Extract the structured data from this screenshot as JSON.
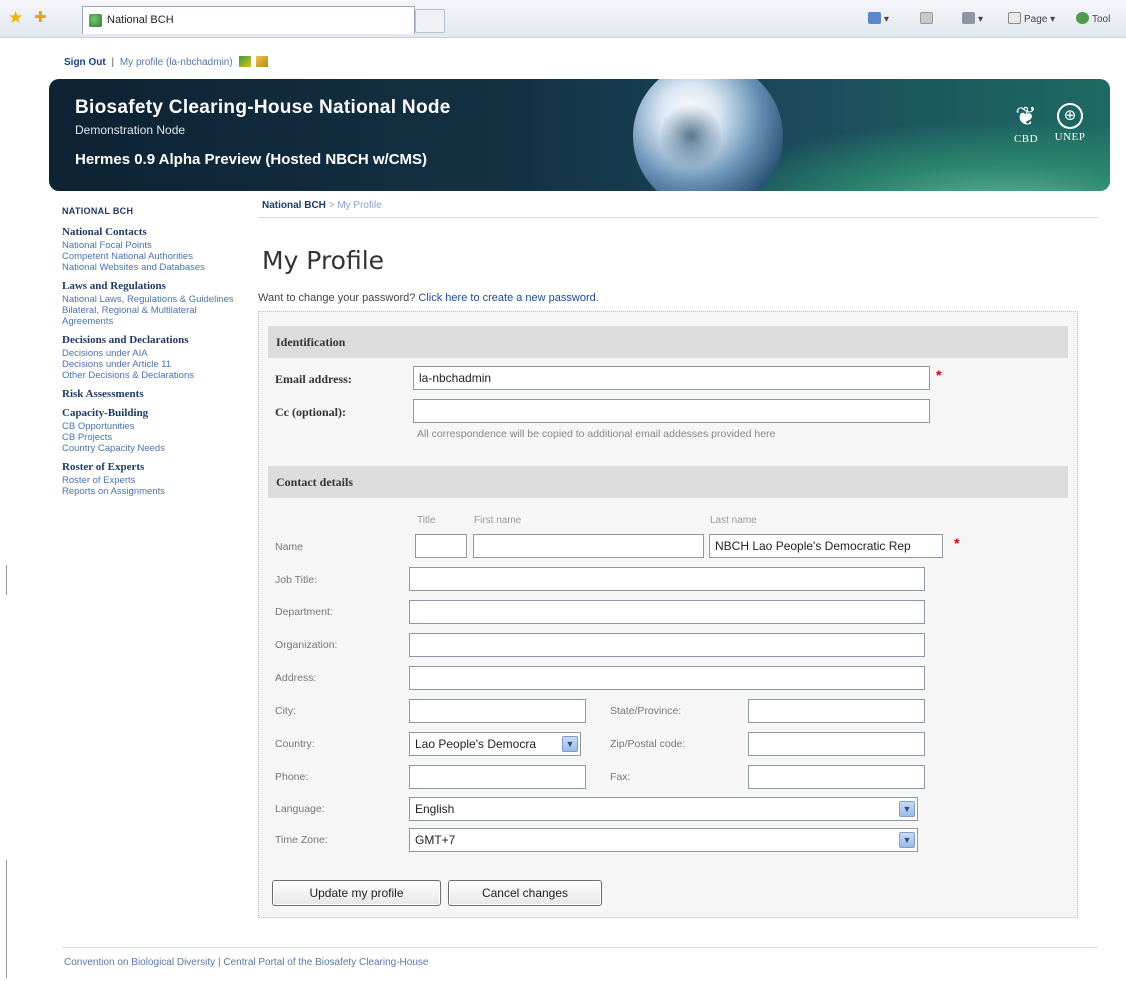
{
  "browser": {
    "tab_title": "National BCH",
    "commands": [
      {
        "label": "▾",
        "icon": "home-icon"
      },
      {
        "label": "",
        "icon": "feeds-icon"
      },
      {
        "label": "▾",
        "icon": "print-icon"
      },
      {
        "label": "Page ▾",
        "icon": "page-icon"
      },
      {
        "label": "Tool",
        "icon": "tools-icon"
      }
    ]
  },
  "toplinks": {
    "sign_out": "Sign Out",
    "separator": "|",
    "my_profile": "My profile",
    "user": "(la-nbchadmin)"
  },
  "banner": {
    "title": "Biosafety Clearing-House National Node",
    "subtitle": "Demonstration Node",
    "hermes": "Hermes 0.9 Alpha Preview (Hosted NBCH w/CMS)",
    "logo_cbd": "CBD",
    "logo_unep": "UNEP"
  },
  "sidebar": {
    "heading": "NATIONAL BCH",
    "groups": [
      {
        "title": "National Contacts",
        "links": [
          "National Focal Points",
          "Competent National Authorities",
          "National Websites and Databases"
        ]
      },
      {
        "title": "Laws and Regulations",
        "links": [
          "National Laws, Regulations & Guidelines",
          "Bilateral, Regional & Multilateral Agreements"
        ]
      },
      {
        "title": "Decisions and Declarations",
        "links": [
          "Decisions under AIA",
          "Decisions under Article 11",
          "Other Decisions & Declarations"
        ]
      },
      {
        "title": "Risk Assessments",
        "links": []
      },
      {
        "title": "Capacity-Building",
        "links": [
          "CB Opportunities",
          "CB Projects",
          "Country Capacity Needs"
        ]
      },
      {
        "title": "Roster of Experts",
        "links": [
          "Roster of Experts",
          "Reports on Assignments"
        ]
      }
    ]
  },
  "breadcrumb": {
    "root": "National BCH",
    "sep": ">",
    "current": "My Profile"
  },
  "page": {
    "title": "My Profile",
    "pw_prompt": "Want to change your password?",
    "pw_link": "Click here to create a new password."
  },
  "identification": {
    "heading": "Identification",
    "email_label": "Email address:",
    "email_value": "la-nbchadmin",
    "cc_label": "Cc (optional):",
    "cc_value": "",
    "cc_hint": "All correspondence will be copied to additional email addesses provided here"
  },
  "contact": {
    "heading": "Contact details",
    "col_title": "Title",
    "col_first": "First name",
    "col_last": "Last name",
    "name_label": "Name",
    "name_title": "",
    "name_first": "",
    "name_last": "NBCH Lao People's Democratic Rep",
    "job_label": "Job Title:",
    "dept_label": "Department:",
    "org_label": "Organization:",
    "address_label": "Address:",
    "city_label": "City:",
    "state_label": "State/Province:",
    "country_label": "Country:",
    "country_value": "Lao People's Democra",
    "zip_label": "Zip/Postal code:",
    "phone_label": "Phone:",
    "fax_label": "Fax:",
    "language_label": "Language:",
    "language_value": "English",
    "timezone_label": "Time Zone:",
    "timezone_value": "GMT+7"
  },
  "buttons": {
    "update": "Update my profile",
    "cancel": "Cancel changes"
  },
  "footer": {
    "cbd": "Convention on Biological Diversity",
    "sep": "|",
    "portal": "Central Portal of the Biosafety Clearing-House"
  },
  "required_mark": "*"
}
